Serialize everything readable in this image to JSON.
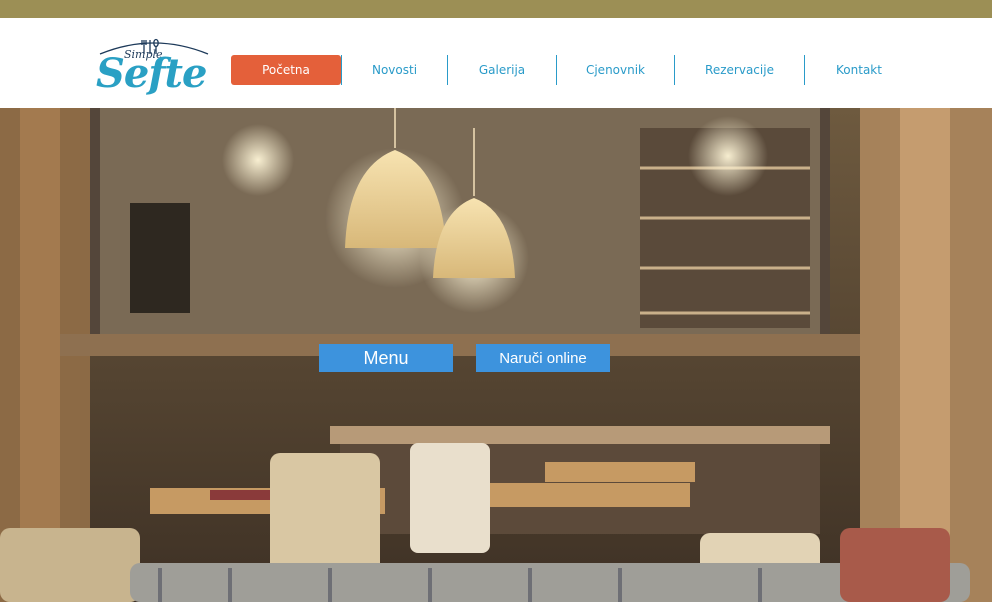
{
  "brand": {
    "logo_top": "Simple",
    "logo_main": "Sefte"
  },
  "nav": {
    "items": [
      {
        "label": "Početna",
        "active": true
      },
      {
        "label": "Novosti"
      },
      {
        "label": "Galerija"
      },
      {
        "label": "Cjenovnik"
      },
      {
        "label": "Rezervacije"
      },
      {
        "label": "Kontakt"
      }
    ]
  },
  "hero": {
    "buttons": {
      "menu": "Menu",
      "order_online": "Naruči online"
    }
  },
  "colors": {
    "top_bar": "#9c8f55",
    "nav_active_bg": "#e4603a",
    "nav_text": "#2a9bc9",
    "cta_bg": "#3d93dd",
    "logo_color": "#2aa0c4"
  },
  "icons": [
    "cutlery-icon"
  ]
}
